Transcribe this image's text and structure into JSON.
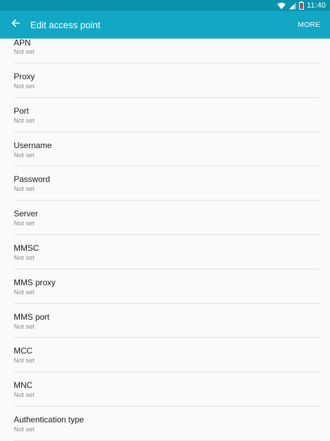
{
  "status_bar": {
    "time": "11:40",
    "icons": [
      "wifi-icon",
      "signal-icon",
      "battery-icon"
    ],
    "color": "#0a93ad"
  },
  "app_bar": {
    "title": "Edit access point",
    "more_label": "MORE",
    "back_icon": "arrow-back-icon",
    "color": "#12a7c4"
  },
  "items": [
    {
      "label": "APN",
      "value": "Not set"
    },
    {
      "label": "Proxy",
      "value": "Not set"
    },
    {
      "label": "Port",
      "value": "Not set"
    },
    {
      "label": "Username",
      "value": "Not set"
    },
    {
      "label": "Password",
      "value": "Not set"
    },
    {
      "label": "Server",
      "value": "Not set"
    },
    {
      "label": "MMSC",
      "value": "Not set"
    },
    {
      "label": "MMS proxy",
      "value": "Not set"
    },
    {
      "label": "MMS port",
      "value": "Not set"
    },
    {
      "label": "MCC",
      "value": "Not set"
    },
    {
      "label": "MNC",
      "value": "Not set"
    },
    {
      "label": "Authentication type",
      "value": "Not set"
    }
  ]
}
